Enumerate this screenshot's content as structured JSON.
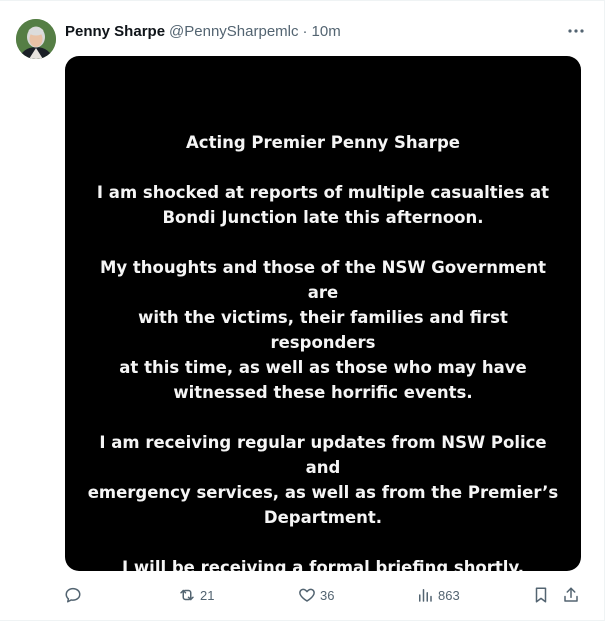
{
  "author": {
    "display_name": "Penny Sharpe",
    "handle": "@PennySharpemlc",
    "separator": "·",
    "timestamp": "10m"
  },
  "statement": {
    "title": "Acting Premier Penny Sharpe",
    "paragraphs": [
      "I am shocked at reports of multiple casualties at\nBondi Junction late this afternoon.",
      "My thoughts and those of the NSW Government are\nwith the victims, their families and first responders\nat this time, as well as those who may have\nwitnessed these horrific events.",
      "I am receiving regular updates from NSW Police and\nemergency services, as well as from the Premier’s\nDepartment.",
      "I will be receiving a formal briefing shortly."
    ]
  },
  "actions": {
    "reply_icon": "reply-icon",
    "retweet_icon": "retweet-icon",
    "retweets": "21",
    "like_icon": "heart-icon",
    "likes": "36",
    "views_icon": "views-icon",
    "views": "863",
    "bookmark_icon": "bookmark-icon",
    "share_icon": "share-icon"
  },
  "colors": {
    "text_primary": "#0f1419",
    "text_secondary": "#536471",
    "media_background": "#000000",
    "media_text": "#f5f5f5"
  }
}
